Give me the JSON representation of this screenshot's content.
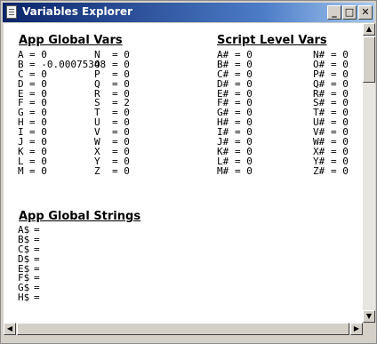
{
  "window": {
    "title": "Variables Explorer",
    "buttons": {
      "minimize": "_",
      "maximize": "□",
      "close": "✕"
    }
  },
  "sections": {
    "app_global_vars": "App Global Vars",
    "script_level_vars": "Script Level Vars",
    "app_global_strings": "App Global Strings"
  },
  "app_vars_col1": [
    {
      "name": "A",
      "value": "= 0"
    },
    {
      "name": "B",
      "value": "= -0.00075348"
    },
    {
      "name": "C",
      "value": "= 0"
    },
    {
      "name": "D",
      "value": "= 0"
    },
    {
      "name": "E",
      "value": "= 0"
    },
    {
      "name": "F",
      "value": "= 0"
    },
    {
      "name": "G",
      "value": "= 0"
    },
    {
      "name": "H",
      "value": "= 0"
    },
    {
      "name": "I",
      "value": "= 0"
    },
    {
      "name": "J",
      "value": "= 0"
    },
    {
      "name": "K",
      "value": "= 0"
    },
    {
      "name": "L",
      "value": "= 0"
    },
    {
      "name": "M",
      "value": "= 0"
    }
  ],
  "app_vars_col2": [
    {
      "name": "N",
      "value": "= 0"
    },
    {
      "name": "O",
      "value": "= 0"
    },
    {
      "name": "P",
      "value": "= 0"
    },
    {
      "name": "Q",
      "value": "= 0"
    },
    {
      "name": "R",
      "value": "= 0"
    },
    {
      "name": "S",
      "value": "= 2"
    },
    {
      "name": "T",
      "value": "= 0"
    },
    {
      "name": "U",
      "value": "= 0"
    },
    {
      "name": "V",
      "value": "= 0"
    },
    {
      "name": "W",
      "value": "= 0"
    },
    {
      "name": "X",
      "value": "= 0"
    },
    {
      "name": "Y",
      "value": "= 0"
    },
    {
      "name": "Z",
      "value": "= 0"
    }
  ],
  "script_vars_col1": [
    {
      "name": "A#",
      "value": "= 0"
    },
    {
      "name": "B#",
      "value": "= 0"
    },
    {
      "name": "C#",
      "value": "= 0"
    },
    {
      "name": "D#",
      "value": "= 0"
    },
    {
      "name": "E#",
      "value": "= 0"
    },
    {
      "name": "F#",
      "value": "= 0"
    },
    {
      "name": "G#",
      "value": "= 0"
    },
    {
      "name": "H#",
      "value": "= 0"
    },
    {
      "name": "I#",
      "value": "= 0"
    },
    {
      "name": "J#",
      "value": "= 0"
    },
    {
      "name": "K#",
      "value": "= 0"
    },
    {
      "name": "L#",
      "value": "= 0"
    },
    {
      "name": "M#",
      "value": "= 0"
    }
  ],
  "script_vars_col2": [
    {
      "name": "N#",
      "value": "= 0"
    },
    {
      "name": "O#",
      "value": "= 0"
    },
    {
      "name": "P#",
      "value": "= 0"
    },
    {
      "name": "Q#",
      "value": "= 0"
    },
    {
      "name": "R#",
      "value": "= 0"
    },
    {
      "name": "S#",
      "value": "= 0"
    },
    {
      "name": "T#",
      "value": "= 0"
    },
    {
      "name": "U#",
      "value": "= 0"
    },
    {
      "name": "V#",
      "value": "= 0"
    },
    {
      "name": "W#",
      "value": "= 0"
    },
    {
      "name": "X#",
      "value": "= 0"
    },
    {
      "name": "Y#",
      "value": "= 0"
    },
    {
      "name": "Z#",
      "value": "= 0"
    }
  ],
  "app_strings": [
    {
      "name": "A$",
      "value": "="
    },
    {
      "name": "B$",
      "value": "="
    },
    {
      "name": "C$",
      "value": "="
    },
    {
      "name": "D$",
      "value": "="
    },
    {
      "name": "E$",
      "value": "="
    },
    {
      "name": "F$",
      "value": "="
    },
    {
      "name": "G$",
      "value": "="
    },
    {
      "name": "H$",
      "value": "="
    }
  ],
  "scrollbars": {
    "up_arrow": "▲",
    "down_arrow": "▼",
    "left_arrow": "◀",
    "right_arrow": "▶"
  }
}
